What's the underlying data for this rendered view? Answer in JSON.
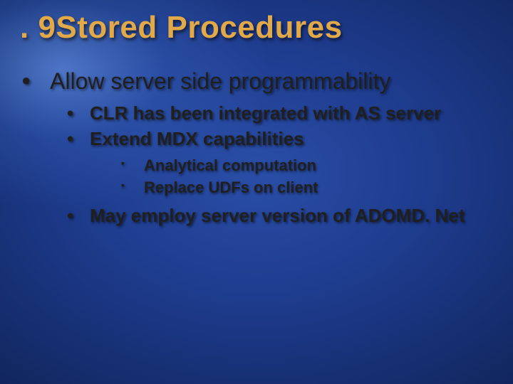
{
  "title": ". 9Stored Procedures",
  "level1": {
    "item": "Allow server side programmability",
    "level2": [
      "CLR has been integrated with AS server",
      "Extend MDX capabilities",
      "May employ server version of ADOMD. Net"
    ],
    "level3": [
      "Analytical computation",
      "Replace UDFs on client"
    ]
  }
}
